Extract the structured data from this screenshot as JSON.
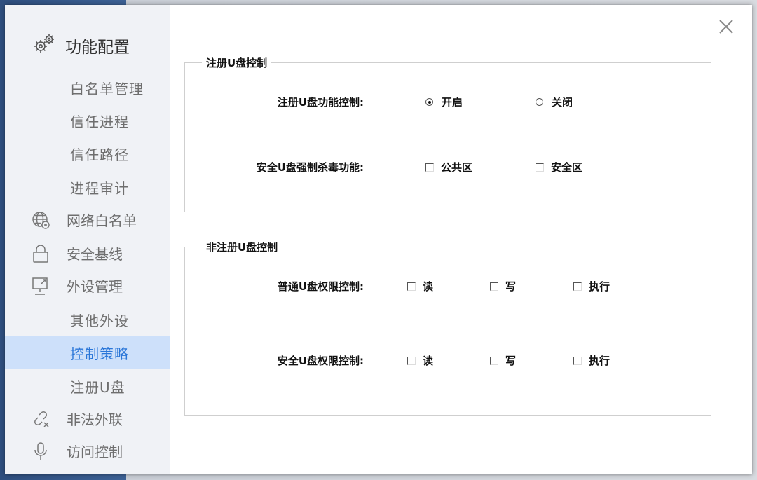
{
  "sidebar": {
    "header": {
      "title": "功能配置",
      "icon": "gear-icon"
    },
    "items": [
      {
        "label": "白名单管理",
        "type": "sub"
      },
      {
        "label": "信任进程",
        "type": "sub"
      },
      {
        "label": "信任路径",
        "type": "sub"
      },
      {
        "label": "进程审计",
        "type": "sub"
      },
      {
        "label": "网络白名单",
        "type": "main",
        "icon": "globe-icon"
      },
      {
        "label": "安全基线",
        "type": "main",
        "icon": "lock-icon"
      },
      {
        "label": "外设管理",
        "type": "main",
        "icon": "monitor-icon"
      },
      {
        "label": "其他外设",
        "type": "sub"
      },
      {
        "label": "控制策略",
        "type": "sub",
        "active": true
      },
      {
        "label": "注册U盘",
        "type": "sub"
      },
      {
        "label": "非法外联",
        "type": "main",
        "icon": "broken-link-icon"
      },
      {
        "label": "访问控制",
        "type": "main",
        "icon": "microphone-icon"
      }
    ],
    "active_color": "#2a76d8",
    "active_bg": "#cde0fa"
  },
  "registered": {
    "title": "注册U盘控制",
    "function_label": "注册U盘功能控制:",
    "function_options": [
      {
        "label": "开启",
        "checked": true
      },
      {
        "label": "关闭",
        "checked": false
      }
    ],
    "antivirus_label": "安全U盘强制杀毒功能:",
    "antivirus_options": [
      {
        "label": "公共区",
        "checked": false
      },
      {
        "label": "安全区",
        "checked": false
      }
    ]
  },
  "unregistered": {
    "title": "非注册U盘控制",
    "normal_label": "普通U盘权限控制:",
    "normal_options": [
      {
        "label": "读",
        "checked": false
      },
      {
        "label": "写",
        "checked": false
      },
      {
        "label": "执行",
        "checked": false
      }
    ],
    "secure_label": "安全U盘权限控制:",
    "secure_options": [
      {
        "label": "读",
        "checked": false
      },
      {
        "label": "写",
        "checked": false
      },
      {
        "label": "执行",
        "checked": false
      }
    ]
  }
}
